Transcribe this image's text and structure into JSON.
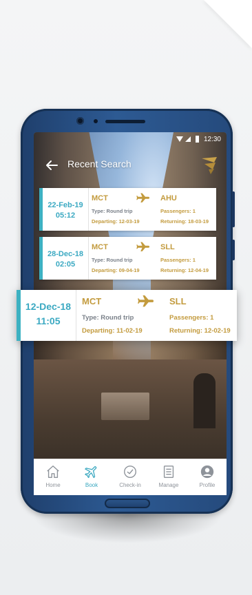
{
  "status_bar": {
    "time": "12:30"
  },
  "app_bar": {
    "title": "Recent Search"
  },
  "colors": {
    "accent": "#3db1c2",
    "gold": "#c39b3e",
    "nav_active": "#3aa8c0"
  },
  "searches": [
    {
      "date": "22-Feb-19",
      "time": "05:12",
      "from": "MCT",
      "to": "AHU",
      "type": "Type: Round trip",
      "passengers": "Passengers: 1",
      "departing": "Departing: 12-03-19",
      "returning": "Returning: 18-03-19"
    },
    {
      "date": "28-Dec-18",
      "time": "02:05",
      "from": "MCT",
      "to": "SLL",
      "type": "Type: Round trip",
      "passengers": "Passengers: 1",
      "departing": "Departing: 09-04-19",
      "returning": "Returning: 12-04-19"
    },
    {
      "date": "12-Dec-18",
      "time": "11:05",
      "from": "MCT",
      "to": "SLL",
      "type": "Type: Round trip",
      "passengers": "Passengers: 1",
      "departing": "Departing: 11-02-19",
      "returning": "Returning: 12-02-19"
    }
  ],
  "bottom_nav": [
    {
      "label": "Home",
      "icon": "home-icon"
    },
    {
      "label": "Book",
      "icon": "plane-icon",
      "active": true
    },
    {
      "label": "Check-in",
      "icon": "check-circle-icon"
    },
    {
      "label": "Manage",
      "icon": "list-icon"
    },
    {
      "label": "Profile",
      "icon": "user-icon"
    }
  ]
}
